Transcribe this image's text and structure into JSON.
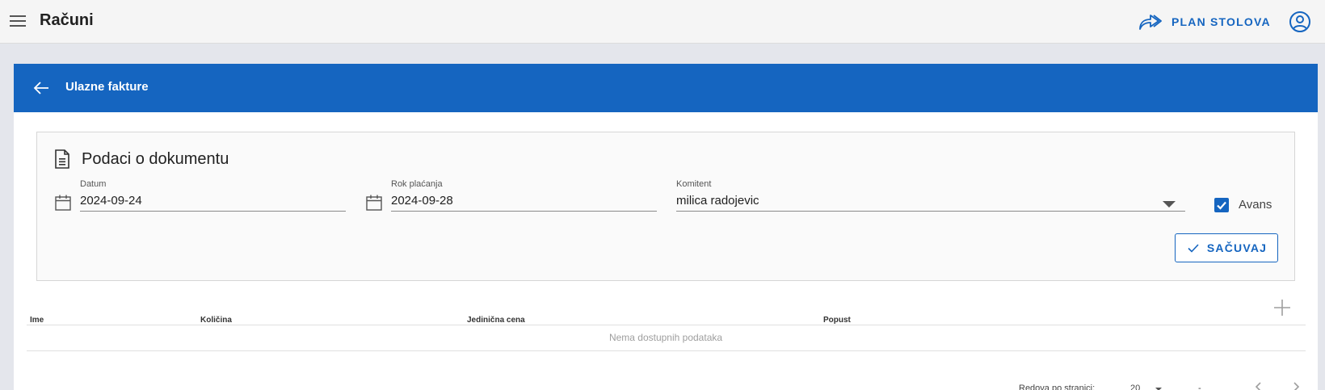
{
  "topbar": {
    "title": "Računi",
    "plan_button_label": "PLAN STOLOVA",
    "icons": {
      "menu": "menu-icon",
      "plan": "forward-arrow-icon",
      "user": "account-circle-icon"
    },
    "accent_color": "#1565c0"
  },
  "card": {
    "header_title": "Ulazne fakture",
    "header_color": "#1565c0",
    "section_title": "Podaci o dokumentu",
    "fields": {
      "datum": {
        "label": "Datum",
        "value": "2024-09-24"
      },
      "rok": {
        "label": "Rok plaćanja",
        "value": "2024-09-28"
      },
      "komitent": {
        "label": "Komitent",
        "value": "milica radojevic"
      }
    },
    "avans": {
      "label": "Avans",
      "checked": true
    },
    "save_label": "SAČUVAJ"
  },
  "table": {
    "columns": [
      "Ime",
      "Količina",
      "Jedinična cena",
      "Popust"
    ],
    "empty_text": "Nema dostupnih podataka",
    "rows_per_page_label": "Redova po stranici:",
    "rows_per_page_value": "20",
    "range_text": "-"
  }
}
